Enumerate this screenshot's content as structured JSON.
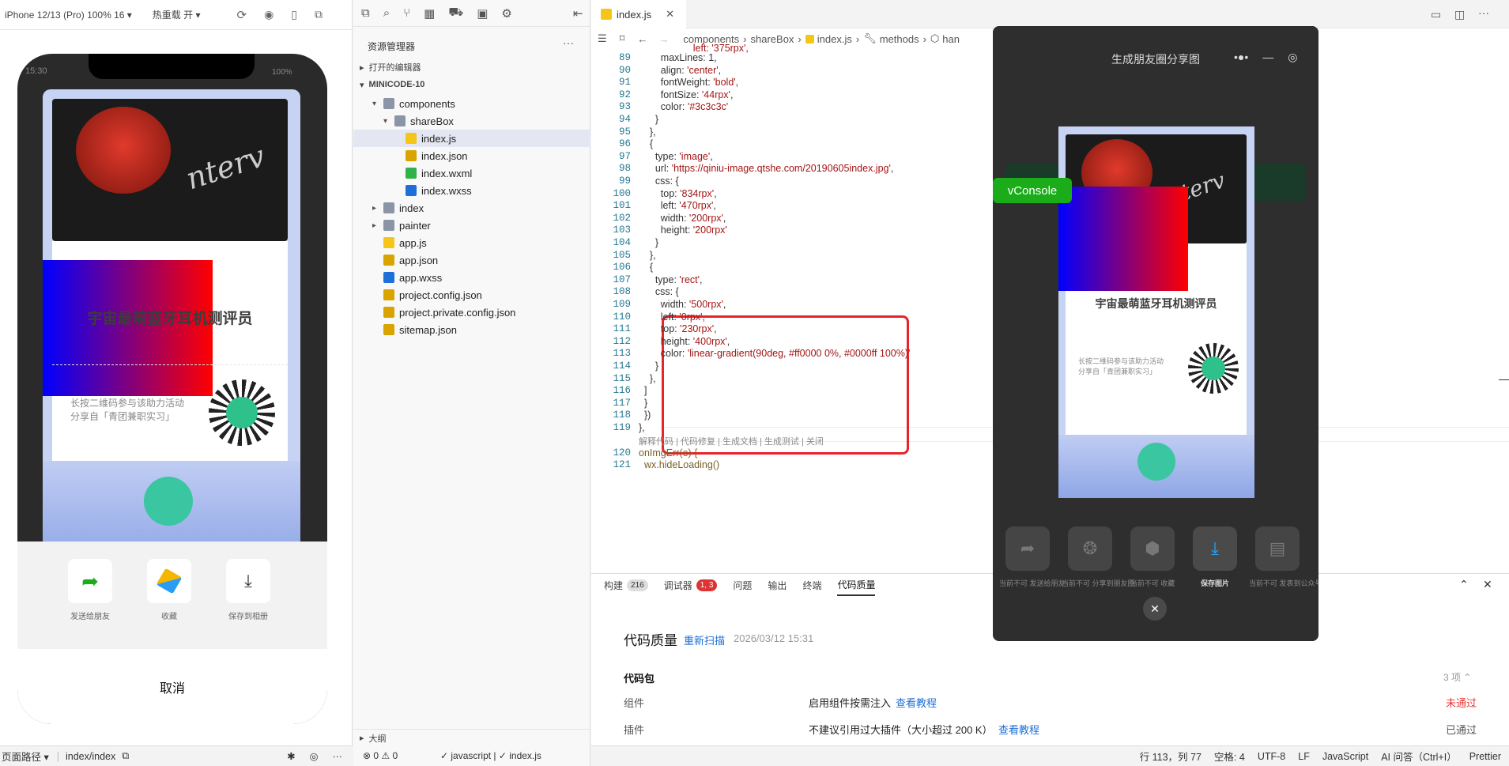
{
  "simulator": {
    "device": "iPhone 12/13 (Pro) 100% 16 ▾",
    "hot_reload": "热重载 开 ▾",
    "time": "15:30",
    "battery": "100%",
    "poster_title": "宇宙最萌蓝牙耳机测评员",
    "qr_hint_line1": "长按二维码参与该助力活动",
    "qr_hint_line2": "分享自「青团兼职实习」",
    "share_actions": [
      {
        "label": "发送给朋友",
        "icon": "share-arrow-icon"
      },
      {
        "label": "收藏",
        "icon": "cube-icon"
      },
      {
        "label": "保存到相册",
        "icon": "download-icon"
      }
    ],
    "cancel": "取消",
    "page_path_label": "页面路径 ▾",
    "page_path": "index/index"
  },
  "explorer": {
    "title": "资源管理器",
    "more": "···",
    "open_editors": "打开的编辑器",
    "project": "MINICODE-10",
    "outline": "大纲",
    "tree": [
      {
        "label": "components",
        "type": "folder-open",
        "depth": 1
      },
      {
        "label": "shareBox",
        "type": "folder-open",
        "depth": 2
      },
      {
        "label": "index.js",
        "type": "js",
        "depth": 3,
        "selected": true
      },
      {
        "label": "index.json",
        "type": "json",
        "depth": 3
      },
      {
        "label": "index.wxml",
        "type": "wxml",
        "depth": 3
      },
      {
        "label": "index.wxss",
        "type": "wxss",
        "depth": 3
      },
      {
        "label": "index",
        "type": "folder",
        "depth": 1
      },
      {
        "label": "painter",
        "type": "folder",
        "depth": 1
      },
      {
        "label": "app.js",
        "type": "js",
        "depth": 1
      },
      {
        "label": "app.json",
        "type": "json",
        "depth": 1
      },
      {
        "label": "app.wxss",
        "type": "wxss",
        "depth": 1
      },
      {
        "label": "project.config.json",
        "type": "json",
        "depth": 1
      },
      {
        "label": "project.private.config.json",
        "type": "json",
        "depth": 1
      },
      {
        "label": "sitemap.json",
        "type": "json",
        "depth": 1
      }
    ],
    "errors": "⊗ 0 ⚠ 0",
    "lang_status": "✓ javascript | ✓ index.js"
  },
  "editor": {
    "tab": "index.js",
    "breadcrumb": [
      "components",
      "shareBox",
      "index.js",
      "methods",
      "han"
    ],
    "lines": [
      {
        "n": "89",
        "t": "        maxLines: 1,"
      },
      {
        "n": "90",
        "t": "        align: 'center',"
      },
      {
        "n": "91",
        "t": "        fontWeight: 'bold',"
      },
      {
        "n": "92",
        "t": "        fontSize: '44rpx',"
      },
      {
        "n": "93",
        "t": "        color: '#3c3c3c'"
      },
      {
        "n": "94",
        "t": "      }"
      },
      {
        "n": "95",
        "t": "    },"
      },
      {
        "n": "96",
        "t": "    {"
      },
      {
        "n": "97",
        "t": "      type: 'image',"
      },
      {
        "n": "98",
        "t": "      url: 'https://qiniu-image.qtshe.com/20190605index.jpg',"
      },
      {
        "n": "99",
        "t": "      css: {"
      },
      {
        "n": "100",
        "t": "        top: '834rpx',"
      },
      {
        "n": "101",
        "t": "        left: '470rpx',"
      },
      {
        "n": "102",
        "t": "        width: '200rpx',"
      },
      {
        "n": "103",
        "t": "        height: '200rpx'"
      },
      {
        "n": "104",
        "t": "      }"
      },
      {
        "n": "105",
        "t": "    },"
      },
      {
        "n": "106",
        "t": "    {"
      },
      {
        "n": "107",
        "t": "      type: 'rect',"
      },
      {
        "n": "108",
        "t": "      css: {"
      },
      {
        "n": "109",
        "t": "        width: '500rpx',"
      },
      {
        "n": "110",
        "t": "        left: '0rpx',"
      },
      {
        "n": "111",
        "t": "        top: '230rpx',"
      },
      {
        "n": "112",
        "t": "        height: '400rpx',"
      },
      {
        "n": "113",
        "t": "        color: 'linear-gradient(90deg, #ff0000 0%, #0000ff 100%)'"
      },
      {
        "n": "114",
        "t": "      }"
      },
      {
        "n": "115",
        "t": "    },"
      },
      {
        "n": "116",
        "t": "  ]"
      },
      {
        "n": "117",
        "t": "  }"
      },
      {
        "n": "118",
        "t": "  })"
      },
      {
        "n": "119",
        "t": "},"
      }
    ],
    "codelens": "解释代码 | 代码修复 | 生成文档 | 生成测试 | 关闭",
    "lines_after": [
      {
        "n": "120",
        "t": "onImgErr(e) {"
      },
      {
        "n": "121",
        "t": "  wx.hideLoading()"
      }
    ],
    "top_partial": "        left: '375rpx',"
  },
  "panel": {
    "tabs": [
      {
        "label": "构建",
        "badge": "216"
      },
      {
        "label": "调试器",
        "badge": "1, 3"
      },
      {
        "label": "问题"
      },
      {
        "label": "输出"
      },
      {
        "label": "终端"
      },
      {
        "label": "代码质量",
        "active": true
      }
    ],
    "title": "代码质量",
    "rescan": "重新扫描",
    "timestamp": "2026/03/12 15:31",
    "section": "代码包",
    "section_count": "3 项 ⌃",
    "rows": [
      {
        "name": "组件",
        "desc": "启用组件按需注入",
        "link": "查看教程",
        "status": "未通过"
      },
      {
        "name": "插件",
        "desc": "不建议引用过大插件（大小超过 200 K）",
        "link": "查看教程",
        "status": "已通过"
      }
    ]
  },
  "overlay": {
    "title": "生成朋友圈分享图",
    "vconsole": "vConsole",
    "poster_title": "宇宙最萌蓝牙耳机测评员",
    "qr_hint_line1": "长按二维码参与该助力活动",
    "qr_hint_line2": "分享自「青团兼职实习」",
    "actions": [
      {
        "label": "当前不可 发送给朋友",
        "icon": "share-arrow-icon"
      },
      {
        "label": "当前不可 分享到朋友圈",
        "icon": "aperture-icon"
      },
      {
        "label": "当前不可 收藏",
        "icon": "cube-icon"
      },
      {
        "label": "保存图片",
        "icon": "download-icon"
      },
      {
        "label": "当前不可 发表到公众号",
        "icon": "doc-icon"
      }
    ]
  },
  "status": {
    "position": "行 113，列 77",
    "spaces": "空格: 4",
    "encoding": "UTF-8",
    "eol": "LF",
    "language": "JavaScript",
    "ai": "AI 问答（Ctrl+I）",
    "formatter": "Prettier"
  }
}
